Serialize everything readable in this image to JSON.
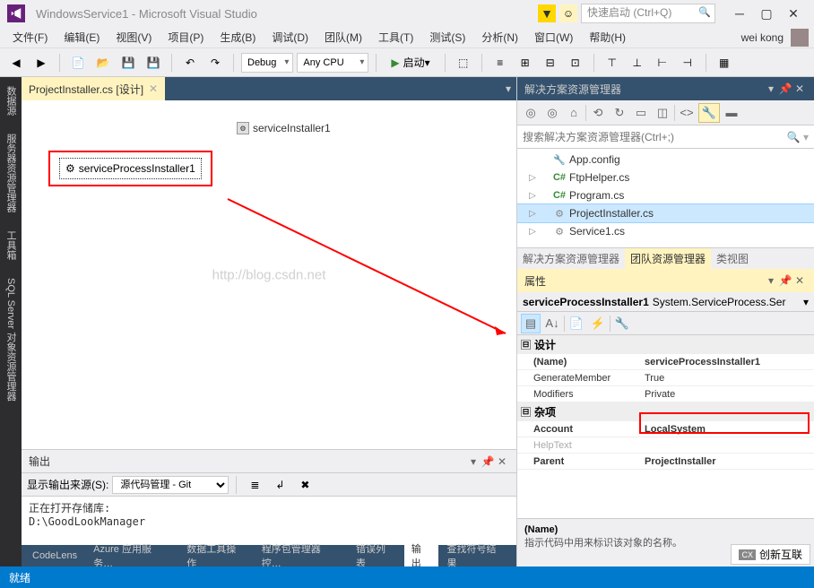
{
  "title": "WindowsService1 - Microsoft Visual Studio",
  "quicklaunch_placeholder": "快速启动 (Ctrl+Q)",
  "user": "wei kong",
  "menu": [
    "文件(F)",
    "编辑(E)",
    "视图(V)",
    "项目(P)",
    "生成(B)",
    "调试(D)",
    "团队(M)",
    "工具(T)",
    "测试(S)",
    "分析(N)",
    "窗口(W)",
    "帮助(H)"
  ],
  "toolbar": {
    "config": "Debug",
    "platform": "Any CPU",
    "start_label": "启动"
  },
  "left_tabs": [
    "数据源",
    "服务器资源管理器",
    "工具箱",
    "SQL Server 对象资源管理器"
  ],
  "center_tab": "ProjectInstaller.cs [设计]",
  "designer": {
    "item1": "serviceInstaller1",
    "item2_selected": "serviceProcessInstaller1"
  },
  "watermark": "http://blog.csdn.net",
  "solution_explorer": {
    "title": "解决方案资源管理器",
    "search_placeholder": "搜索解决方案资源管理器(Ctrl+;)",
    "items": [
      {
        "label": "App.config",
        "icon": "cfg",
        "indent": 40
      },
      {
        "label": "FtpHelper.cs",
        "icon": "cs",
        "expand": "▷",
        "indent": 40
      },
      {
        "label": "Program.cs",
        "icon": "cs",
        "expand": "▷",
        "indent": 40
      },
      {
        "label": "ProjectInstaller.cs",
        "icon": "cfg",
        "expand": "▷",
        "indent": 40,
        "selected": true
      },
      {
        "label": "Service1.cs",
        "icon": "cfg",
        "expand": "▷",
        "indent": 40
      }
    ],
    "footer_tabs": [
      "解决方案资源管理器",
      "团队资源管理器",
      "类视图"
    ]
  },
  "properties": {
    "title": "属性",
    "object_name": "serviceProcessInstaller1",
    "object_type": "System.ServiceProcess.Ser",
    "categories": [
      {
        "name": "设计",
        "rows": [
          {
            "n": "(Name)",
            "v": "serviceProcessInstaller1",
            "bold": true
          },
          {
            "n": "GenerateMember",
            "v": "True"
          },
          {
            "n": "Modifiers",
            "v": "Private"
          }
        ]
      },
      {
        "name": "杂项",
        "rows": [
          {
            "n": "Account",
            "v": "LocalSystem",
            "bold": true,
            "highlight": true
          },
          {
            "n": "HelpText",
            "v": "",
            "disabled": true
          },
          {
            "n": "Parent",
            "v": "ProjectInstaller",
            "bold": true
          }
        ]
      }
    ],
    "desc_title": "(Name)",
    "desc_text": "指示代码中用来标识该对象的名称。"
  },
  "output": {
    "title": "输出",
    "source_label": "显示输出来源(S):",
    "source_value": "源代码管理 - Git",
    "lines": [
      "正在打开存储库:",
      "D:\\GoodLookManager"
    ]
  },
  "bottom_tabs": [
    "CodeLens",
    "Azure 应用服务…",
    "数据工具操作",
    "程序包管理器控…",
    "错误列表",
    "输出",
    "查找符号结果"
  ],
  "status": "就绪",
  "brand": "创新互联"
}
